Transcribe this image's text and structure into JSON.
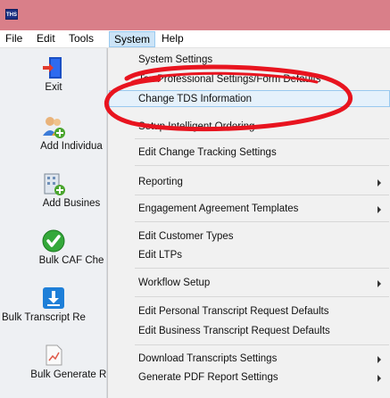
{
  "app": {
    "icon_text": "THS"
  },
  "menubar": {
    "items": [
      {
        "label": "File"
      },
      {
        "label": "Edit"
      },
      {
        "label": "Tools"
      },
      {
        "label": "System"
      },
      {
        "label": "Help"
      }
    ]
  },
  "sidebar": {
    "buttons": [
      {
        "label": "Exit",
        "icon": "exit-door-icon"
      },
      {
        "label": "Add Individua",
        "icon": "add-individual-icon"
      },
      {
        "label": "Add Busines",
        "icon": "add-business-icon"
      },
      {
        "label": "Bulk CAF Che",
        "icon": "checkmark-circle-icon"
      },
      {
        "label": "Bulk Transcript Re",
        "icon": "download-icon"
      },
      {
        "label": "Bulk Generate Re",
        "icon": "report-document-icon"
      }
    ]
  },
  "system_menu": {
    "items": [
      {
        "label": "System Settings"
      },
      {
        "label": "Tax Professional Settings/Form Defaults"
      },
      {
        "label": "Change TDS Information",
        "highlighted": true
      },
      {
        "label": "Setup Intelligent Ordering"
      },
      {
        "label": "Edit Change Tracking Settings"
      },
      {
        "label": "Reporting",
        "submenu": true
      },
      {
        "label": "Engagement Agreement Templates",
        "submenu": true
      },
      {
        "label": "Edit Customer Types"
      },
      {
        "label": "Edit LTPs"
      },
      {
        "label": "Workflow Setup",
        "submenu": true
      },
      {
        "label": "Edit Personal Transcript Request Defaults"
      },
      {
        "label": "Edit Business Transcript Request Defaults"
      },
      {
        "label": "Download Transcripts Settings",
        "submenu": true
      },
      {
        "label": "Generate PDF Report Settings",
        "submenu": true
      }
    ]
  },
  "colors": {
    "titlebar": "#d97f89",
    "menu_open_bg": "#cce4f7",
    "menu_hover_border": "#99c9ef",
    "annotation_red": "#e8141f"
  }
}
